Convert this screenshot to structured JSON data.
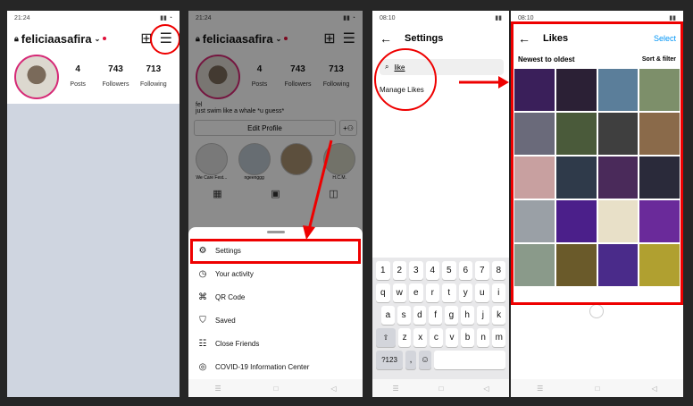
{
  "panel1": {
    "status_time": "21:24",
    "username": "feliciaasafira",
    "posts_count": "4",
    "posts_label": "Posts",
    "followers_count": "743",
    "followers_label": "Followers",
    "following_count": "713",
    "following_label": "Following"
  },
  "panel2": {
    "status_time": "21:24",
    "username": "feliciaasafira",
    "posts_count": "4",
    "posts_label": "Posts",
    "followers_count": "743",
    "followers_label": "Followers",
    "following_count": "713",
    "following_label": "Following",
    "bio_name": "fel",
    "bio_text": "just swim like a whale *u guess*",
    "edit_profile": "Edit Profile",
    "highlights": [
      "We Care Fest...",
      "ngeenggg",
      "",
      "H.C.M."
    ],
    "menu": [
      {
        "label": "Settings",
        "icon": "gear-icon"
      },
      {
        "label": "Your activity",
        "icon": "activity-icon"
      },
      {
        "label": "QR Code",
        "icon": "qr-icon"
      },
      {
        "label": "Saved",
        "icon": "bookmark-icon"
      },
      {
        "label": "Close Friends",
        "icon": "list-icon"
      },
      {
        "label": "COVID-19 Information Center",
        "icon": "info-icon"
      }
    ]
  },
  "panel3": {
    "status_time": "08:10",
    "title": "Settings",
    "search_value": "like",
    "result": "Manage Likes",
    "kb_row1": [
      "1",
      "2",
      "3",
      "4",
      "5",
      "6",
      "7",
      "8"
    ],
    "kb_row2": [
      "q",
      "w",
      "e",
      "r",
      "t",
      "y",
      "u",
      "i"
    ],
    "kb_row3": [
      "a",
      "s",
      "d",
      "f",
      "g",
      "h",
      "j",
      "k"
    ],
    "kb_row4": [
      "z",
      "x",
      "c",
      "v",
      "b",
      "n",
      "m"
    ],
    "kb_sym": "?123",
    "kb_comma": ","
  },
  "panel4": {
    "status_time": "08:10",
    "title": "Likes",
    "select": "Select",
    "sort_label": "Newest to oldest",
    "sort_filter": "Sort & filter",
    "photo_colors": [
      "#3a1f5a",
      "#2b2035",
      "#5b7e9a",
      "#7d8f6a",
      "#6a6a7a",
      "#4a5a3a",
      "#3f3f3f",
      "#8a6a4a",
      "#c8a0a0",
      "#2f3a4a",
      "#4a2a5a",
      "#2a2a3a",
      "#9aa0a6",
      "#4b1f8a",
      "#e8e0c8",
      "#6a2a9a",
      "#8a9a8a",
      "#6a5a2a",
      "#4a2b8a",
      "#b0a030"
    ]
  },
  "colors": {
    "accent_red": "#e00000",
    "link_blue": "#0095f6"
  }
}
